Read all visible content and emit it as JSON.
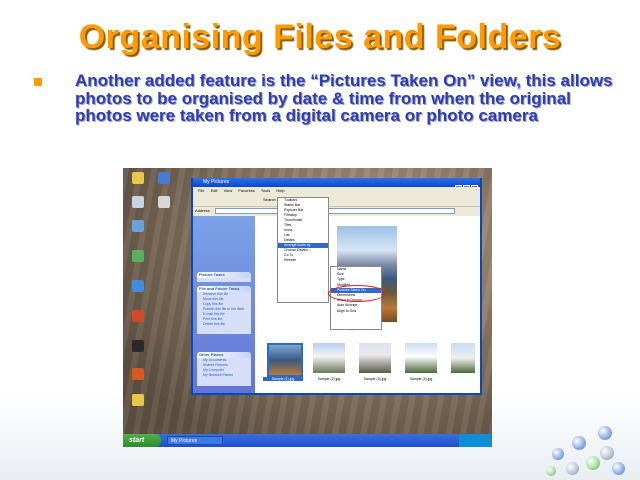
{
  "slide": {
    "title": "Organising Files and Folders",
    "bullet": "Another added feature is the “Pictures Taken On” view, this allows photos to be organised by date & time from when the original photos were taken from a digital camera or photo camera"
  },
  "screenshot": {
    "window_title": "My Pictures",
    "start_label": "start",
    "taskbar_item": "My Pictures",
    "menu_items": [
      "File",
      "Edit",
      "View",
      "Favorites",
      "Tools",
      "Help"
    ],
    "toolbar": {
      "search": "Search",
      "folders": "Folders"
    },
    "address": "Address",
    "view_menu": [
      "Toolbars",
      "Status Bar",
      "Explorer Bar",
      "Filmstrip",
      "Thumbnails",
      "Tiles",
      "Icons",
      "List",
      "Details",
      "Arrange Icons by",
      "Choose Details...",
      "Go To",
      "Refresh"
    ],
    "arrange_menu": [
      "Name",
      "Size",
      "Type",
      "Modified",
      "Pictures Taken On",
      "Dimensions",
      "Show in Groups",
      "Auto Arrange",
      "Align to Grid"
    ],
    "task_pane": {
      "picture_tasks_title": "Picture Tasks",
      "file_tasks_title": "File and Folder Tasks",
      "file_tasks": [
        "Rename this file",
        "Move this file",
        "Copy this file",
        "Publish this file to the Web",
        "E-mail this file",
        "Print this file",
        "Delete this file"
      ],
      "other_places_title": "Other Places",
      "other_places": [
        "My Documents",
        "Shared Pictures",
        "My Computer",
        "My Network Places"
      ]
    },
    "thumb_labels": [
      "Sample (1).jpg",
      "Sample (2).jpg",
      "Sample (3).jpg",
      "Sample (4).jpg"
    ]
  },
  "colors": {
    "title": "#ff9a00",
    "bullet_text": "#2f3db5",
    "accent_ring": "#e02020"
  }
}
